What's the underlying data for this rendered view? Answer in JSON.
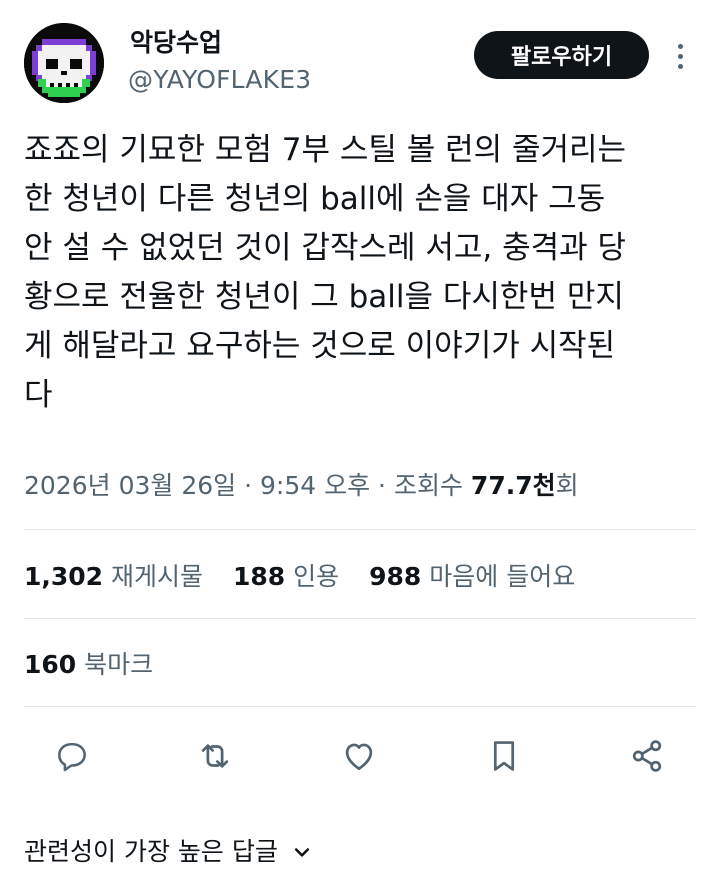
{
  "author": {
    "display_name": "악당수업",
    "handle": "@YAYOFLAKE3",
    "avatar_icon": "skull-icon"
  },
  "follow_button": {
    "label": "팔로우하기"
  },
  "more_icon": "more-vertical-icon",
  "tweet": {
    "text_lines": [
      "죠죠의 기묘한 모험 7부 스틸 볼 런의 줄거리는",
      "한 청년이 다른 청년의 ball에 손을 대자 그동",
      "안 설 수 없었던 것이 갑작스레 서고, 충격과 당",
      "황으로 전율한 청년이 그 ball을 다시한번 만지",
      "게 해달라고 요구하는 것으로 이야기가 시작된",
      "다"
    ]
  },
  "meta": {
    "date": "2026년 03월 26일",
    "sep1": "·",
    "time": "9:54 오후",
    "sep2": "·",
    "views_label": "조회수",
    "views_value": "77.7천",
    "views_suffix": "회"
  },
  "stats": {
    "retweets_value": "1,302",
    "retweets_label": "재게시물",
    "quotes_value": "188",
    "quotes_label": "인용",
    "likes_value": "988",
    "likes_label": "마음에 들어요"
  },
  "bookmarks": {
    "value": "160",
    "label": "북마크"
  },
  "actions": [
    "reply-icon",
    "retweet-icon",
    "like-icon",
    "bookmark-icon",
    "share-icon"
  ],
  "replies_sort": {
    "label": "관련성이 가장 높은 답글",
    "icon": "chevron-down-icon"
  },
  "colors": {
    "text": "#0f1419",
    "secondary": "#536471",
    "divider": "#e1e4e6",
    "button_bg": "#0f1419",
    "avatar_green": "#2fcf4f",
    "avatar_purple": "#7b3fd6"
  }
}
